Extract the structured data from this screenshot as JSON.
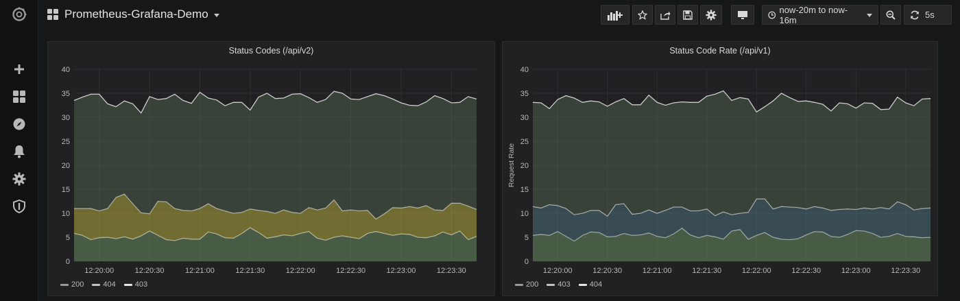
{
  "dashboard": {
    "title": "Prometheus-Grafana-Demo"
  },
  "toolbar": {
    "time_range": "now-20m to now-16m",
    "refresh_interval": "5s"
  },
  "sidebar": {
    "items": [
      {
        "icon": "grafana-logo-icon"
      },
      {
        "icon": "plus-icon"
      },
      {
        "icon": "dashboards-icon"
      },
      {
        "icon": "explore-icon"
      },
      {
        "icon": "bell-icon"
      },
      {
        "icon": "gear-icon"
      },
      {
        "icon": "shield-icon"
      }
    ]
  },
  "colors": {
    "accent": "#e0e0e0",
    "panel_bg": "#212124",
    "page_bg": "#161719"
  },
  "chart_data": [
    {
      "type": "area",
      "title": "Status Codes (/api/v2)",
      "ylabel": "",
      "ylim": [
        0,
        40
      ],
      "yticks": [
        "0",
        "5",
        "10",
        "15",
        "20",
        "25",
        "30",
        "35",
        "40"
      ],
      "xticks": [
        "12:20:00",
        "12:20:30",
        "12:21:00",
        "12:21:30",
        "12:22:00",
        "12:22:30",
        "12:23:00",
        "12:23:30"
      ],
      "stacked": true,
      "grid": true,
      "legend": "bottom-left",
      "legend_items": [
        "200",
        "404",
        "403"
      ],
      "x": [
        "12:19:45",
        "12:19:50",
        "12:19:55",
        "12:20:00",
        "12:20:05",
        "12:20:10",
        "12:20:15",
        "12:20:20",
        "12:20:25",
        "12:20:30",
        "12:20:35",
        "12:20:40",
        "12:20:45",
        "12:20:50",
        "12:20:55",
        "12:21:00",
        "12:21:05",
        "12:21:10",
        "12:21:15",
        "12:21:20",
        "12:21:25",
        "12:21:30",
        "12:21:35",
        "12:21:40",
        "12:21:45",
        "12:21:50",
        "12:21:55",
        "12:22:00",
        "12:22:05",
        "12:22:10",
        "12:22:15",
        "12:22:20",
        "12:22:25",
        "12:22:30",
        "12:22:35",
        "12:22:40",
        "12:22:45",
        "12:22:50",
        "12:22:55",
        "12:23:00",
        "12:23:05",
        "12:23:10",
        "12:23:15",
        "12:23:20",
        "12:23:25",
        "12:23:30",
        "12:23:35",
        "12:23:40",
        "12:23:45"
      ],
      "series": [
        {
          "name": "200",
          "color": "#6a8c5e",
          "values": [
            5.8,
            5.4,
            4.5,
            4.9,
            5.0,
            4.7,
            5.1,
            4.6,
            5.3,
            6.3,
            5.4,
            4.5,
            4.3,
            4.8,
            4.6,
            4.6,
            6.1,
            5.7,
            4.9,
            4.8,
            5.8,
            7.0,
            6.0,
            4.8,
            5.1,
            5.5,
            5.3,
            5.8,
            6.2,
            4.8,
            4.4,
            5.0,
            5.3,
            5.0,
            4.7,
            5.8,
            6.2,
            5.8,
            5.4,
            5.7,
            5.6,
            5.0,
            4.9,
            5.3,
            6.1,
            5.5,
            6.3,
            4.5,
            5.2
          ]
        },
        {
          "name": "404",
          "color": "#b2a93a",
          "values": [
            5.2,
            5.6,
            6.5,
            5.6,
            6.0,
            8.6,
            8.9,
            7.4,
            4.8,
            3.6,
            7.1,
            7.9,
            6.7,
            5.8,
            5.9,
            6.4,
            5.9,
            5.3,
            5.6,
            5.2,
            4.4,
            3.9,
            4.6,
            5.6,
            4.9,
            5.2,
            4.9,
            4.2,
            5.0,
            5.9,
            6.7,
            7.8,
            5.2,
            5.7,
            5.8,
            4.8,
            2.6,
            4.1,
            5.8,
            5.4,
            5.8,
            6.1,
            6.7,
            5.4,
            4.5,
            6.6,
            5.8,
            7.0,
            5.6
          ]
        },
        {
          "name": "403",
          "color": "#4e5e4a",
          "values": [
            22.5,
            23.2,
            23.8,
            24.3,
            21.8,
            18.9,
            19.4,
            20.8,
            20.8,
            24.4,
            21.2,
            21.5,
            23.8,
            22.9,
            22.4,
            24.2,
            22.0,
            22.6,
            21.9,
            23.1,
            22.9,
            20.6,
            23.6,
            24.6,
            23.9,
            23.3,
            24.6,
            24.9,
            22.9,
            22.4,
            22.6,
            22.6,
            24.5,
            23.1,
            23.2,
            23.7,
            26.1,
            24.6,
            22.6,
            21.9,
            21.1,
            21.3,
            21.6,
            23.8,
            23.3,
            20.9,
            21.0,
            22.8,
            23.0
          ]
        }
      ]
    },
    {
      "type": "area",
      "title": "Status Code Rate (/api/v1)",
      "ylabel": "Request Rate",
      "ylim": [
        0,
        40
      ],
      "yticks": [
        "0",
        "5",
        "10",
        "15",
        "20",
        "25",
        "30",
        "35",
        "40"
      ],
      "xticks": [
        "12:20:00",
        "12:20:30",
        "12:21:00",
        "12:21:30",
        "12:22:00",
        "12:22:30",
        "12:23:00",
        "12:23:30"
      ],
      "stacked": true,
      "grid": true,
      "legend": "bottom-left",
      "legend_items": [
        "200",
        "403",
        "404"
      ],
      "x": [
        "12:19:45",
        "12:19:50",
        "12:19:55",
        "12:20:00",
        "12:20:05",
        "12:20:10",
        "12:20:15",
        "12:20:20",
        "12:20:25",
        "12:20:30",
        "12:20:35",
        "12:20:40",
        "12:20:45",
        "12:20:50",
        "12:20:55",
        "12:21:00",
        "12:21:05",
        "12:21:10",
        "12:21:15",
        "12:21:20",
        "12:21:25",
        "12:21:30",
        "12:21:35",
        "12:21:40",
        "12:21:45",
        "12:21:50",
        "12:21:55",
        "12:22:00",
        "12:22:05",
        "12:22:10",
        "12:22:15",
        "12:22:20",
        "12:22:25",
        "12:22:30",
        "12:22:35",
        "12:22:40",
        "12:22:45",
        "12:22:50",
        "12:22:55",
        "12:23:00",
        "12:23:05",
        "12:23:10",
        "12:23:15",
        "12:23:20",
        "12:23:25",
        "12:23:30",
        "12:23:35",
        "12:23:40",
        "12:23:45"
      ],
      "series": [
        {
          "name": "200",
          "color": "#6a8c5e",
          "values": [
            5.4,
            5.6,
            5.4,
            6.2,
            5.2,
            4.2,
            5.4,
            6.1,
            6.0,
            5.1,
            5.2,
            5.8,
            5.4,
            5.5,
            5.9,
            5.2,
            4.9,
            5.7,
            6.9,
            5.5,
            4.9,
            5.4,
            5.1,
            4.6,
            6.3,
            6.6,
            4.6,
            5.4,
            6.0,
            5.0,
            4.6,
            4.5,
            4.7,
            5.5,
            6.2,
            6.1,
            5.2,
            5.0,
            5.6,
            6.4,
            6.3,
            5.8,
            5.0,
            5.2,
            5.8,
            5.2,
            5.1,
            4.9,
            5.0
          ]
        },
        {
          "name": "403",
          "color": "#4c7078",
          "values": [
            6.0,
            5.5,
            6.4,
            5.4,
            5.8,
            5.5,
            4.6,
            4.5,
            4.6,
            4.3,
            6.6,
            6.2,
            4.4,
            4.5,
            4.8,
            4.8,
            5.7,
            5.6,
            4.4,
            5.0,
            5.6,
            5.5,
            4.4,
            5.7,
            3.4,
            3.4,
            5.6,
            7.6,
            7.0,
            5.9,
            6.8,
            6.8,
            6.5,
            5.4,
            5.2,
            5.0,
            5.4,
            5.8,
            5.3,
            4.4,
            4.8,
            5.1,
            6.2,
            5.7,
            6.6,
            6.6,
            5.6,
            6.1,
            6.1
          ]
        },
        {
          "name": "404",
          "color": "#4e5e4a",
          "values": [
            21.7,
            21.9,
            20.0,
            22.1,
            23.5,
            24.3,
            23.1,
            22.8,
            22.6,
            22.9,
            21.4,
            21.9,
            22.8,
            22.6,
            23.9,
            23.1,
            21.9,
            21.7,
            21.9,
            22.6,
            22.6,
            23.5,
            25.3,
            25.2,
            23.8,
            24.1,
            23.6,
            18.1,
            19.2,
            22.5,
            23.6,
            22.8,
            22.1,
            22.5,
            21.7,
            21.6,
            20.7,
            22.2,
            21.9,
            21.1,
            21.9,
            22.0,
            20.4,
            20.8,
            21.8,
            21.2,
            21.7,
            22.8,
            22.8
          ]
        }
      ]
    }
  ]
}
